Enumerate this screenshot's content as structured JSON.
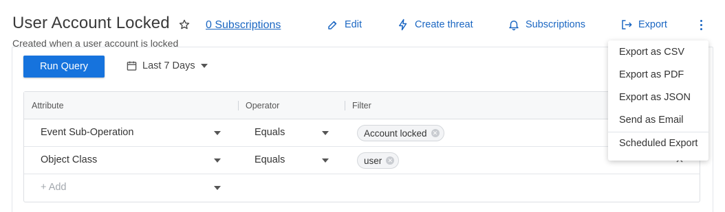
{
  "header": {
    "title": "User Account Locked",
    "subscriptions_link": "0 Subscriptions",
    "subtitle": "Created when a user account is locked"
  },
  "actions": {
    "edit": "Edit",
    "create_threat": "Create threat",
    "subscriptions": "Subscriptions",
    "export": "Export"
  },
  "toolbar": {
    "run_query": "Run Query",
    "date_range": "Last 7 Days"
  },
  "table": {
    "columns": [
      "Attribute",
      "Operator",
      "Filter"
    ],
    "rows": [
      {
        "attribute": "Event Sub-Operation",
        "operator": "Equals",
        "filter": "Account locked"
      },
      {
        "attribute": "Object Class",
        "operator": "Equals",
        "filter": "user"
      }
    ],
    "add_placeholder": "+ Add"
  },
  "export_menu": {
    "items": [
      "Export as CSV",
      "Export as PDF",
      "Export as JSON",
      "Send as Email",
      "Scheduled Export"
    ]
  },
  "colors": {
    "accent": "#1a66c2",
    "primary_button": "#1673dd"
  }
}
